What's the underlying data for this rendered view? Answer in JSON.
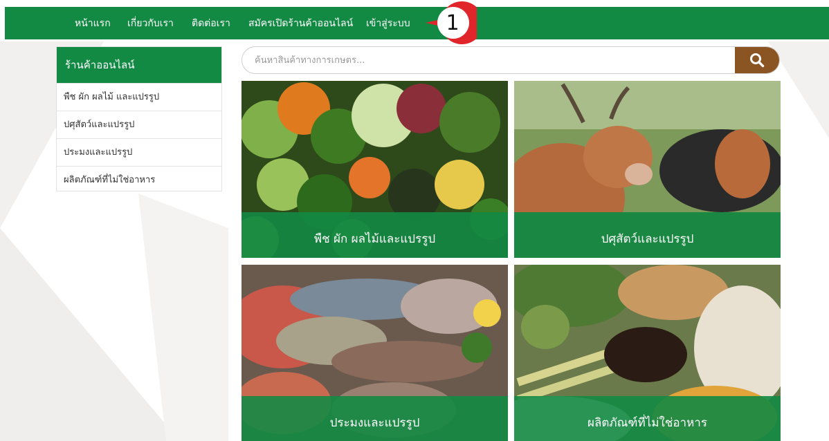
{
  "nav": {
    "items": [
      {
        "label": "หน้าแรก"
      },
      {
        "label": "เกี่ยวกับเรา"
      },
      {
        "label": "ติดต่อเรา"
      },
      {
        "label": "สมัครเปิดร้านค้าออนไลน์"
      },
      {
        "label": "เข้าสู่ระบบ"
      }
    ]
  },
  "callout": {
    "number": "1",
    "color": "#e0262b"
  },
  "sidebar": {
    "title": "ร้านค้าออนไลน์",
    "items": [
      {
        "label": "พืช ผัก ผลไม้ และแปรรูป"
      },
      {
        "label": "ปศุสัตว์และแปรรูป"
      },
      {
        "label": "ประมงและแปรรูป"
      },
      {
        "label": "ผลิตภัณฑ์ที่ไม่ใช่อาหาร"
      }
    ]
  },
  "search": {
    "placeholder": "ค้นหาสินค้าทางการเกษตร...",
    "button_icon": "search-icon"
  },
  "categories": [
    {
      "label": "พืช ผัก ผลไม้และแปรรูป",
      "image": "vegetables"
    },
    {
      "label": "ปศุสัตว์และแปรรูป",
      "image": "cow"
    },
    {
      "label": "ประมงและแปรรูป",
      "image": "seafood"
    },
    {
      "label": "ผลิตภัณฑ์ที่ไม่ใช่อาหาร",
      "image": "herbs-spices"
    }
  ],
  "colors": {
    "brand_green": "#138a44",
    "search_button": "#8a5522"
  }
}
